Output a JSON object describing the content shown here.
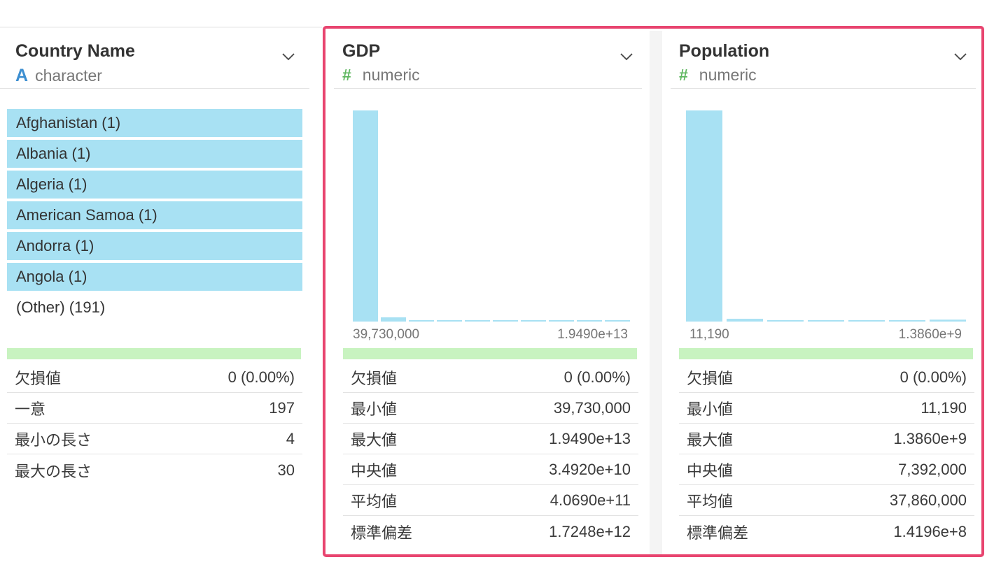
{
  "columns": [
    {
      "name": "Country Name",
      "type_icon": "A",
      "type": "character",
      "categories": [
        "Afghanistan (1)",
        "Albania (1)",
        "Algeria (1)",
        "American Samoa (1)",
        "Andorra (1)",
        "Angola (1)"
      ],
      "other": "(Other) (191)",
      "stats": [
        {
          "label": "欠損値",
          "value": "0 (0.00%)"
        },
        {
          "label": "一意",
          "value": "197"
        },
        {
          "label": "最小の長さ",
          "value": "4"
        },
        {
          "label": "最大の長さ",
          "value": "30"
        }
      ]
    },
    {
      "name": "GDP",
      "type_icon": "#",
      "type": "numeric",
      "axis_min": "39,730,000",
      "axis_max": "1.9490e+13",
      "histogram": [
        1.0,
        0.02,
        0.006,
        0.006,
        0.006,
        0.006,
        0.006,
        0.006,
        0.006,
        0.006
      ],
      "stats": [
        {
          "label": "欠損値",
          "value": "0 (0.00%)"
        },
        {
          "label": "最小値",
          "value": "39,730,000"
        },
        {
          "label": "最大値",
          "value": "1.9490e+13"
        },
        {
          "label": "中央値",
          "value": "3.4920e+10"
        },
        {
          "label": "平均値",
          "value": "4.0690e+11"
        },
        {
          "label": "標準偏差",
          "value": "1.7248e+12"
        }
      ]
    },
    {
      "name": "Population",
      "type_icon": "#",
      "type": "numeric",
      "axis_min": "11,190",
      "axis_max": "1.3860e+9",
      "histogram": [
        1.0,
        0.013,
        0.006,
        0.006,
        0.006,
        0.006,
        0.009
      ],
      "stats": [
        {
          "label": "欠損値",
          "value": "0 (0.00%)"
        },
        {
          "label": "最小値",
          "value": "11,190"
        },
        {
          "label": "最大値",
          "value": "1.3860e+9"
        },
        {
          "label": "中央値",
          "value": "7,392,000"
        },
        {
          "label": "平均値",
          "value": "37,860,000"
        },
        {
          "label": "標準偏差",
          "value": "1.4196e+8"
        }
      ]
    }
  ],
  "colors": {
    "bar": "#a8e1f3",
    "highlight_border": "#e8446f",
    "quality_bar": "#c8f3c0",
    "character_icon": "#3d8fd1",
    "numeric_icon": "#5fb760"
  }
}
